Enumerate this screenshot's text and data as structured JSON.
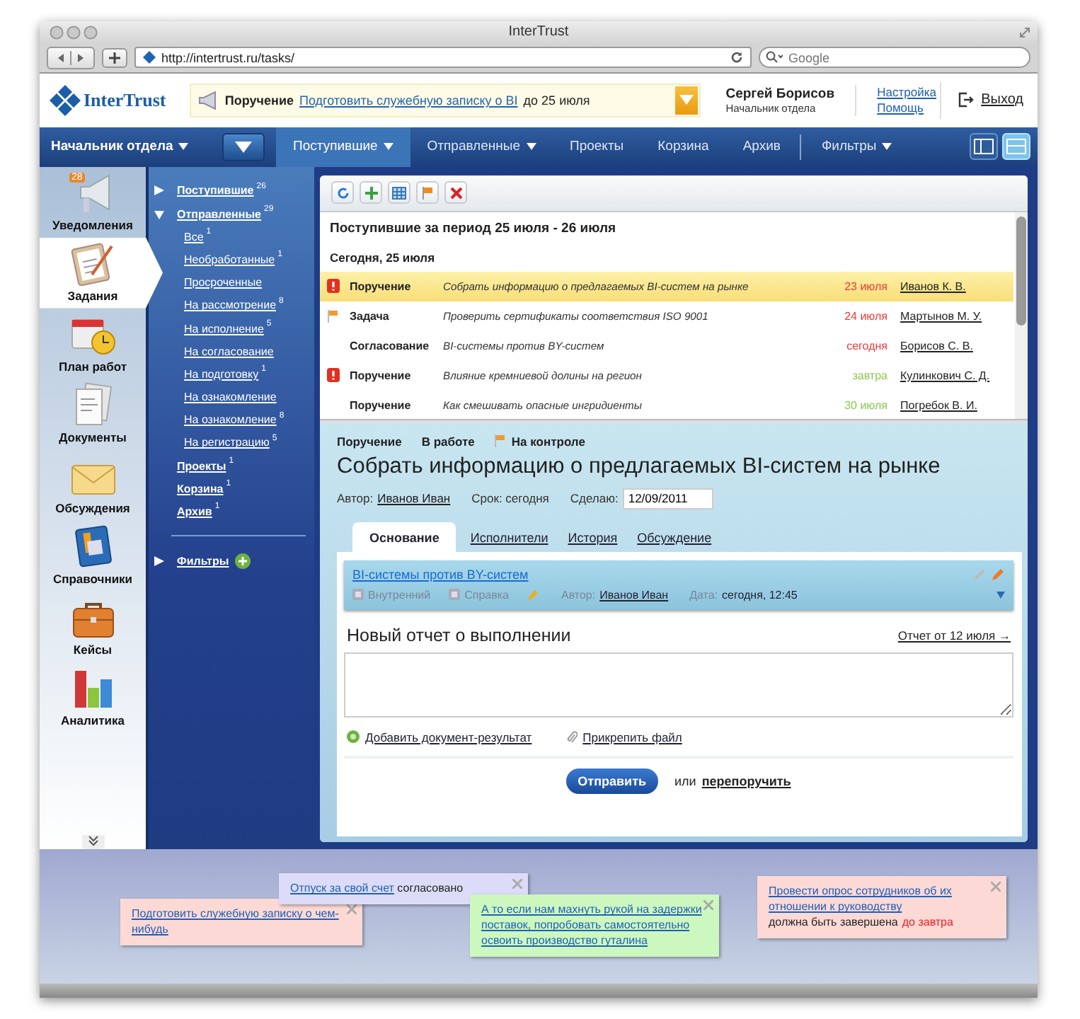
{
  "window": {
    "title": "InterTrust"
  },
  "browser": {
    "url": "http://intertrust.ru/tasks/",
    "search_placeholder": "Google"
  },
  "header": {
    "logo": "InterTrust",
    "notice": {
      "type": "Поручение",
      "link": "Подготовить служебную записку о BI",
      "suffix": "до 25 июля"
    },
    "user": {
      "name": "Сергей Борисов",
      "role": "Начальник отдела"
    },
    "links": [
      "Настройка",
      "Помощь"
    ],
    "logout": "Выход"
  },
  "nav": {
    "role": "Начальник отдела",
    "items": [
      {
        "label": "Поступившие",
        "dropdown": true,
        "selected": true
      },
      {
        "label": "Отправленные",
        "dropdown": true,
        "selected": false
      },
      {
        "label": "Проекты",
        "dropdown": false,
        "selected": false
      },
      {
        "label": "Корзина",
        "dropdown": false,
        "selected": false
      },
      {
        "label": "Архив",
        "dropdown": false,
        "selected": false
      },
      {
        "label": "Фильтры",
        "dropdown": true,
        "selected": false
      }
    ],
    "views": [
      {
        "selected": false
      },
      {
        "selected": true
      }
    ]
  },
  "modules": [
    {
      "label": "Уведомления",
      "badge": "28",
      "selected": false
    },
    {
      "label": "Задания",
      "selected": true
    },
    {
      "label": "План работ",
      "selected": false
    },
    {
      "label": "Документы",
      "selected": false
    },
    {
      "label": "Обсуждения",
      "selected": false
    },
    {
      "label": "Справочники",
      "selected": false
    },
    {
      "label": "Кейсы",
      "selected": false
    },
    {
      "label": "Аналитика",
      "selected": false
    }
  ],
  "folders": [
    {
      "kind": "branch",
      "label": "Поступившие",
      "count": "26",
      "expanded": false
    },
    {
      "kind": "branch",
      "label": "Отправленные",
      "count": "29",
      "expanded": true,
      "children": [
        {
          "label": "Все",
          "count": "1"
        },
        {
          "label": "Необработанные",
          "count": "1"
        },
        {
          "label": "Просроченные"
        },
        {
          "label": "На рассмотрение",
          "count": "8"
        },
        {
          "label": "На исполнение",
          "count": "5"
        },
        {
          "label": "На согласование"
        },
        {
          "label": "На подготовку",
          "count": "1"
        },
        {
          "label": "На ознакомление"
        },
        {
          "label": "На ознакомление",
          "count": "8"
        },
        {
          "label": "На регистрацию",
          "count": "5"
        }
      ]
    },
    {
      "kind": "leaf",
      "label": "Проекты",
      "count": "1"
    },
    {
      "kind": "leaf",
      "label": "Корзина",
      "count": "1"
    },
    {
      "kind": "leaf",
      "label": "Архив",
      "count": "1"
    }
  ],
  "filters": {
    "label": "Фильтры",
    "expanded": false
  },
  "list": {
    "title": "Поступившие за период 25 июля - 26 июля",
    "group": "Сегодня, 25 июля",
    "rows": [
      {
        "urgent": true,
        "flagged": false,
        "type": "Поручение",
        "subject": "Собрать информацию о предлагаемых BI-систем на рынке",
        "due": "23 июля",
        "overdue": true,
        "person": "Иванов К. В.",
        "selected": true
      },
      {
        "urgent": false,
        "flagged": true,
        "type": "Задача",
        "subject": "Проверить сертификаты соответствия ISO 9001",
        "due": "24 июля",
        "overdue": true,
        "person": "Мартынов М. У.",
        "selected": false
      },
      {
        "urgent": false,
        "flagged": false,
        "type": "Согласование",
        "subject": "BI-системы против BY-систем",
        "due": "сегодня",
        "overdue": true,
        "person": "Борисов С. В.",
        "selected": false
      },
      {
        "urgent": true,
        "flagged": false,
        "type": "Поручение",
        "subject": "Влияние кремниевой долины на регион",
        "due": "завтра",
        "overdue": false,
        "person": "Кулинкович С. Д.",
        "selected": false
      },
      {
        "urgent": false,
        "flagged": false,
        "type": "Поручение",
        "subject": "Как смешивать опасные ингридиенты",
        "due": "30 июля",
        "overdue": false,
        "person": "Погребок В. И.",
        "selected": false
      }
    ]
  },
  "detail": {
    "type": "Поручение",
    "status": "В работе",
    "control": "На контроле",
    "title": "Собрать информацию о предлагаемых BI-систем на рынке",
    "author_label": "Автор:",
    "author": "Иванов Иван",
    "deadline": "Срок: сегодня",
    "done_label": "Сделаю:",
    "done_value": "12/09/2011",
    "tabs": [
      {
        "label": "Основание",
        "selected": true
      },
      {
        "label": "Исполнители",
        "selected": false
      },
      {
        "label": "История",
        "selected": false
      },
      {
        "label": "Обсуждение",
        "selected": false
      }
    ],
    "basis": {
      "link": "BI-системы против BY-систем",
      "tags": [
        "Внутренний",
        "Справка"
      ],
      "author_label": "Автор:",
      "author": "Иванов Иван",
      "date_label": "Дата:",
      "date": "сегодня, 12:45"
    },
    "report": {
      "title": "Новый отчет о выполнении",
      "prev_link": "Отчет от 12 июля →",
      "actions": [
        "Добавить документ-результат",
        "Прикрепить файл"
      ],
      "submit": "Отправить",
      "or": "или",
      "reassign": "перепоручить"
    }
  },
  "notes": [
    {
      "link": "Подготовить служебную записку о чем-нибудь",
      "color": "#fdd9d5"
    },
    {
      "link": "Отпуск за свой счет",
      "text": "согласовано",
      "color": "#dcdcf8"
    },
    {
      "link": "А то если нам махнуть рукой на задержки поставок, попробовать самостоятельно освоить производство гуталина",
      "color": "#ccf8c0"
    },
    {
      "link": "Провести опрос сотрудников об их отношении к руководству",
      "text": "должна быть завершена",
      "alert": "до завтра",
      "color": "#fdd9d5"
    }
  ]
}
